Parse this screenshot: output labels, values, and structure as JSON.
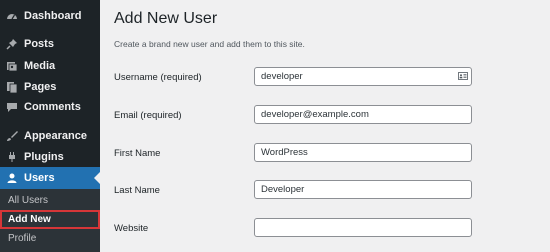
{
  "sidebar": {
    "items": [
      {
        "label": "Dashboard",
        "icon": "dashboard-icon"
      },
      {
        "label": "Posts",
        "icon": "pin-icon"
      },
      {
        "label": "Media",
        "icon": "media-icon"
      },
      {
        "label": "Pages",
        "icon": "pages-icon"
      },
      {
        "label": "Comments",
        "icon": "comment-icon"
      },
      {
        "label": "Appearance",
        "icon": "brush-icon"
      },
      {
        "label": "Plugins",
        "icon": "plug-icon"
      },
      {
        "label": "Users",
        "icon": "user-icon"
      }
    ],
    "submenu": [
      {
        "label": "All Users"
      },
      {
        "label": "Add New"
      },
      {
        "label": "Profile"
      }
    ],
    "active_color": "#2271b1",
    "highlight_color": "#d63638"
  },
  "main": {
    "title": "Add New User",
    "description": "Create a brand new user and add them to this site.",
    "fields": [
      {
        "label": "Username (required)",
        "value": "developer"
      },
      {
        "label": "Email (required)",
        "value": "developer@example.com"
      },
      {
        "label": "First Name",
        "value": "WordPress"
      },
      {
        "label": "Last Name",
        "value": "Developer"
      },
      {
        "label": "Website",
        "value": ""
      }
    ]
  }
}
